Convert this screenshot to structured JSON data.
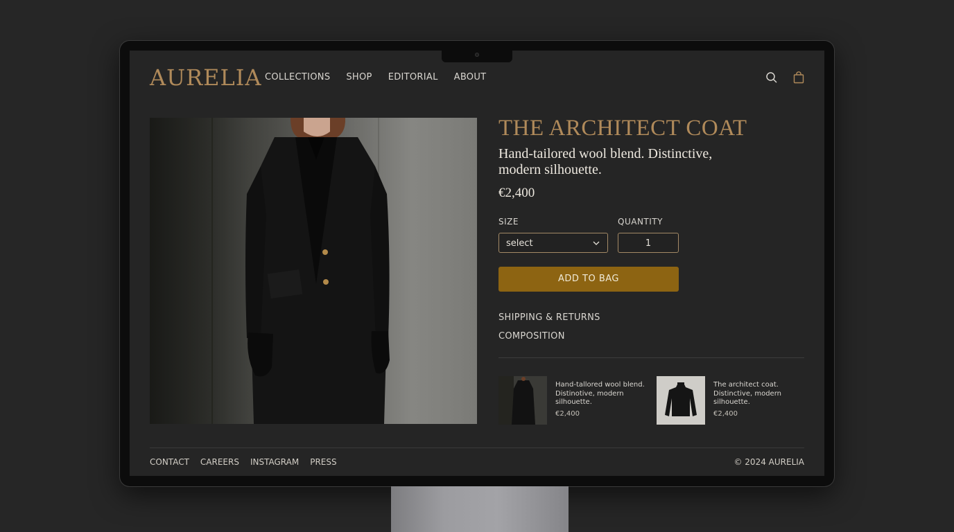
{
  "brand": {
    "logo": "AURELIA"
  },
  "nav": {
    "items": [
      "COLLECTIONS",
      "SHOP",
      "EDITORIAL",
      "ABOUT"
    ]
  },
  "header_icons": [
    "search-icon",
    "shopping-bag-icon"
  ],
  "product": {
    "title": "THE ARCHITECT COAT",
    "subtitle": "Hand-tailored wool blend. Distinctive, modern silhouette.",
    "price": "€2,400",
    "size_label": "SIZE",
    "size_value": "select",
    "quantity_label": "QUANTITY",
    "quantity_value": "1",
    "add_button": "ADD TO BAG"
  },
  "accordions": [
    "SHIPPING & RETURNS",
    "COMPOSITION"
  ],
  "related": [
    {
      "text": "Hand-tallored wool blend. Distinotive, modern silhouette.",
      "price": "€2,400"
    },
    {
      "text": "The architect coat. Distinctive, modern silhouette.",
      "price": "€2,400"
    }
  ],
  "footer": {
    "links": [
      "CONTACT",
      "CAREERS",
      "INSTAGRAM",
      "PRESS"
    ],
    "copyright": "© 2024 AURELIA"
  },
  "colors": {
    "accent": "#b08a5a",
    "button": "#8d6412",
    "background": "#252525"
  }
}
